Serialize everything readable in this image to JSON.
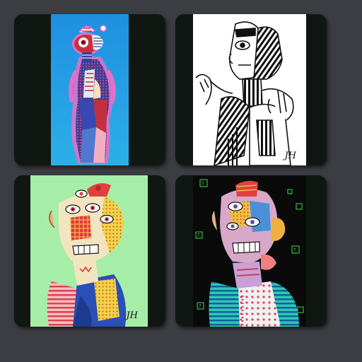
{
  "gallery": {
    "artworks": [
      {
        "subject": "blue-figure-painting",
        "background": "#2aa0e0",
        "signature": ""
      },
      {
        "subject": "line-drawing-face",
        "background": "#ffffff",
        "signature": "JH"
      },
      {
        "subject": "cubist-portrait-green",
        "background": "#a6eea8",
        "signature": "JH"
      },
      {
        "subject": "cubist-portrait-dark",
        "background": "#0a0a0a",
        "signature": ""
      }
    ]
  },
  "colors": {
    "page_background": "#3c3c43",
    "card_background": "#101712"
  }
}
